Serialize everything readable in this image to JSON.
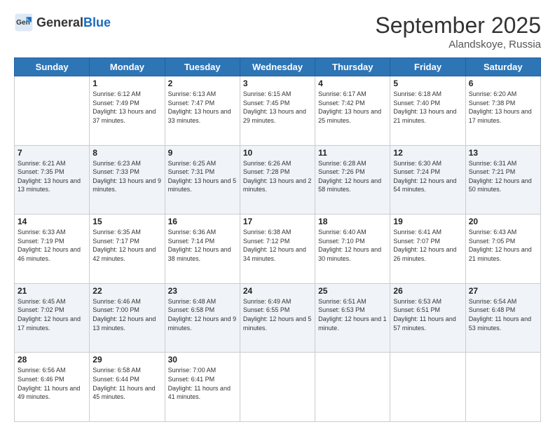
{
  "header": {
    "logo_general": "General",
    "logo_blue": "Blue",
    "title": "September 2025",
    "location": "Alandskoye, Russia"
  },
  "days_of_week": [
    "Sunday",
    "Monday",
    "Tuesday",
    "Wednesday",
    "Thursday",
    "Friday",
    "Saturday"
  ],
  "weeks": [
    [
      {
        "day": "",
        "info": ""
      },
      {
        "day": "1",
        "info": "Sunrise: 6:12 AM\nSunset: 7:49 PM\nDaylight: 13 hours and 37 minutes."
      },
      {
        "day": "2",
        "info": "Sunrise: 6:13 AM\nSunset: 7:47 PM\nDaylight: 13 hours and 33 minutes."
      },
      {
        "day": "3",
        "info": "Sunrise: 6:15 AM\nSunset: 7:45 PM\nDaylight: 13 hours and 29 minutes."
      },
      {
        "day": "4",
        "info": "Sunrise: 6:17 AM\nSunset: 7:42 PM\nDaylight: 13 hours and 25 minutes."
      },
      {
        "day": "5",
        "info": "Sunrise: 6:18 AM\nSunset: 7:40 PM\nDaylight: 13 hours and 21 minutes."
      },
      {
        "day": "6",
        "info": "Sunrise: 6:20 AM\nSunset: 7:38 PM\nDaylight: 13 hours and 17 minutes."
      }
    ],
    [
      {
        "day": "7",
        "info": "Sunrise: 6:21 AM\nSunset: 7:35 PM\nDaylight: 13 hours and 13 minutes."
      },
      {
        "day": "8",
        "info": "Sunrise: 6:23 AM\nSunset: 7:33 PM\nDaylight: 13 hours and 9 minutes."
      },
      {
        "day": "9",
        "info": "Sunrise: 6:25 AM\nSunset: 7:31 PM\nDaylight: 13 hours and 5 minutes."
      },
      {
        "day": "10",
        "info": "Sunrise: 6:26 AM\nSunset: 7:28 PM\nDaylight: 13 hours and 2 minutes."
      },
      {
        "day": "11",
        "info": "Sunrise: 6:28 AM\nSunset: 7:26 PM\nDaylight: 12 hours and 58 minutes."
      },
      {
        "day": "12",
        "info": "Sunrise: 6:30 AM\nSunset: 7:24 PM\nDaylight: 12 hours and 54 minutes."
      },
      {
        "day": "13",
        "info": "Sunrise: 6:31 AM\nSunset: 7:21 PM\nDaylight: 12 hours and 50 minutes."
      }
    ],
    [
      {
        "day": "14",
        "info": "Sunrise: 6:33 AM\nSunset: 7:19 PM\nDaylight: 12 hours and 46 minutes."
      },
      {
        "day": "15",
        "info": "Sunrise: 6:35 AM\nSunset: 7:17 PM\nDaylight: 12 hours and 42 minutes."
      },
      {
        "day": "16",
        "info": "Sunrise: 6:36 AM\nSunset: 7:14 PM\nDaylight: 12 hours and 38 minutes."
      },
      {
        "day": "17",
        "info": "Sunrise: 6:38 AM\nSunset: 7:12 PM\nDaylight: 12 hours and 34 minutes."
      },
      {
        "day": "18",
        "info": "Sunrise: 6:40 AM\nSunset: 7:10 PM\nDaylight: 12 hours and 30 minutes."
      },
      {
        "day": "19",
        "info": "Sunrise: 6:41 AM\nSunset: 7:07 PM\nDaylight: 12 hours and 26 minutes."
      },
      {
        "day": "20",
        "info": "Sunrise: 6:43 AM\nSunset: 7:05 PM\nDaylight: 12 hours and 21 minutes."
      }
    ],
    [
      {
        "day": "21",
        "info": "Sunrise: 6:45 AM\nSunset: 7:02 PM\nDaylight: 12 hours and 17 minutes."
      },
      {
        "day": "22",
        "info": "Sunrise: 6:46 AM\nSunset: 7:00 PM\nDaylight: 12 hours and 13 minutes."
      },
      {
        "day": "23",
        "info": "Sunrise: 6:48 AM\nSunset: 6:58 PM\nDaylight: 12 hours and 9 minutes."
      },
      {
        "day": "24",
        "info": "Sunrise: 6:49 AM\nSunset: 6:55 PM\nDaylight: 12 hours and 5 minutes."
      },
      {
        "day": "25",
        "info": "Sunrise: 6:51 AM\nSunset: 6:53 PM\nDaylight: 12 hours and 1 minute."
      },
      {
        "day": "26",
        "info": "Sunrise: 6:53 AM\nSunset: 6:51 PM\nDaylight: 11 hours and 57 minutes."
      },
      {
        "day": "27",
        "info": "Sunrise: 6:54 AM\nSunset: 6:48 PM\nDaylight: 11 hours and 53 minutes."
      }
    ],
    [
      {
        "day": "28",
        "info": "Sunrise: 6:56 AM\nSunset: 6:46 PM\nDaylight: 11 hours and 49 minutes."
      },
      {
        "day": "29",
        "info": "Sunrise: 6:58 AM\nSunset: 6:44 PM\nDaylight: 11 hours and 45 minutes."
      },
      {
        "day": "30",
        "info": "Sunrise: 7:00 AM\nSunset: 6:41 PM\nDaylight: 11 hours and 41 minutes."
      },
      {
        "day": "",
        "info": ""
      },
      {
        "day": "",
        "info": ""
      },
      {
        "day": "",
        "info": ""
      },
      {
        "day": "",
        "info": ""
      }
    ]
  ]
}
